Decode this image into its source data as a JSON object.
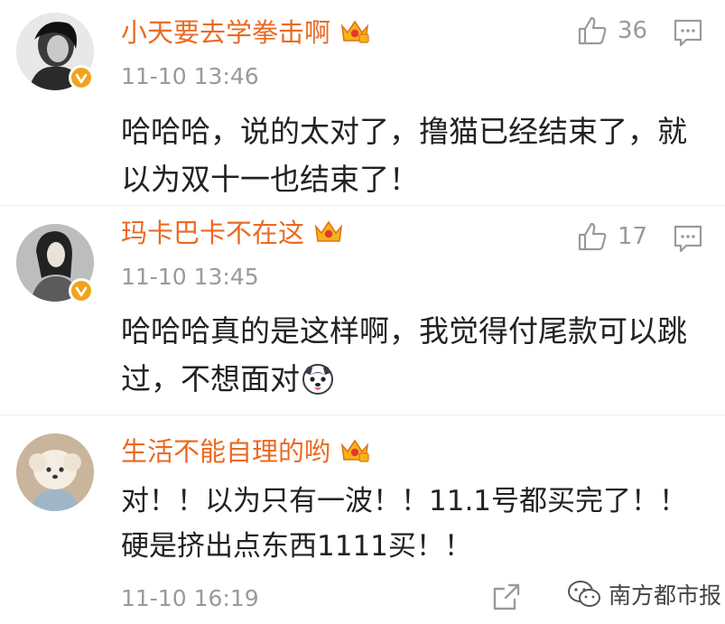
{
  "comments": [
    {
      "username": "小天要去学拳击啊",
      "timestamp": "11-10 13:46",
      "text": "哈哈哈，说的太对了，撸猫已经结束了，就以为双十一也结束了！",
      "likes": "36",
      "verified": true
    },
    {
      "username": "玛卡巴卡不在这",
      "timestamp": "11-10 13:45",
      "text": "哈哈哈真的是这样啊，我觉得付尾款可以跳过，不想面对",
      "emoji": "dog-face-emoji",
      "likes": "17",
      "verified": true
    },
    {
      "username": "生活不能自理的哟",
      "timestamp": "11-10 16:19",
      "text": "对！！以为只有一波！！11.1号都买完了！！硬是挤出点东西1111买！！",
      "verified": false
    }
  ],
  "watermark": {
    "label": "南方都市报",
    "icon": "wechat-icon"
  },
  "colors": {
    "username": "#ea6a22",
    "meta": "#9a9a9a",
    "badge": "#f2a31b"
  }
}
